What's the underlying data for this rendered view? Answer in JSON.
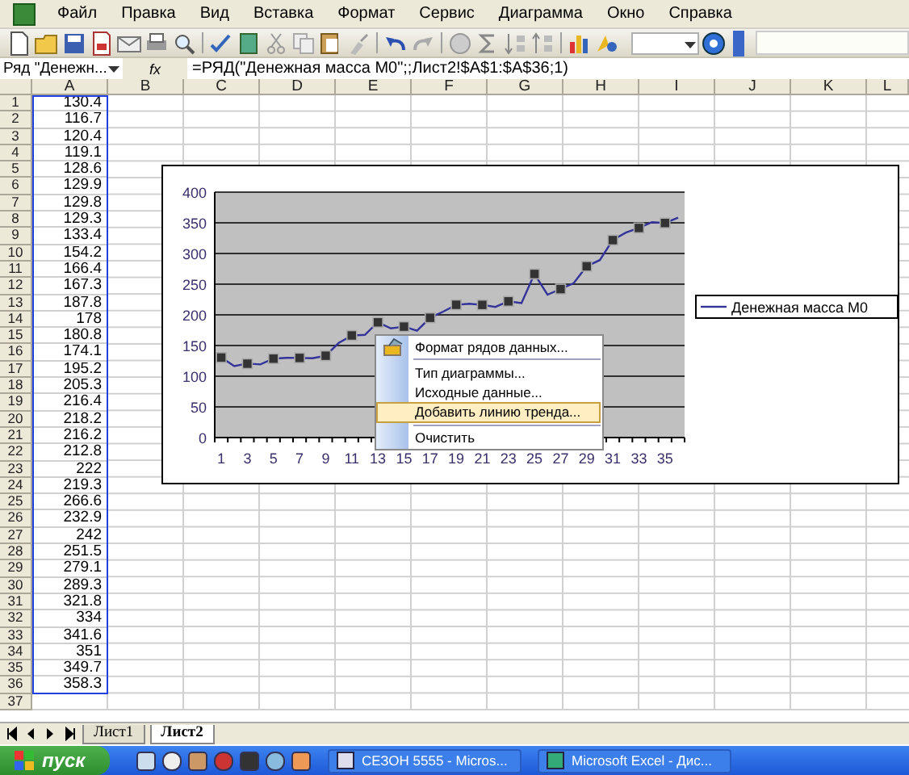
{
  "menu": [
    "Файл",
    "Правка",
    "Вид",
    "Вставка",
    "Формат",
    "Сервис",
    "Диаграмма",
    "Окно",
    "Справка"
  ],
  "formula_bar": {
    "name_box": "Ряд \"Денежн...",
    "fx": "fx",
    "formula": "=РЯД(\"Денежная масса M0\";;Лист2!$A$1:$A$36;1)"
  },
  "sheet": {
    "columns": [
      "A",
      "B",
      "C",
      "D",
      "E",
      "F",
      "G",
      "H",
      "I",
      "J",
      "K",
      "L"
    ],
    "row_numbers": [
      "1",
      "2",
      "3",
      "4",
      "5",
      "6",
      "7",
      "8",
      "9",
      "10",
      "11",
      "12",
      "13",
      "14",
      "15",
      "16",
      "17",
      "18",
      "19",
      "20",
      "21",
      "22",
      "23",
      "24",
      "25",
      "26",
      "27",
      "28",
      "29",
      "30",
      "31",
      "32",
      "33",
      "34",
      "35",
      "36",
      "37"
    ],
    "column_a": [
      "130.4",
      "116.7",
      "120.4",
      "119.1",
      "128.6",
      "129.9",
      "129.8",
      "129.3",
      "133.4",
      "154.2",
      "166.4",
      "167.3",
      "187.8",
      "178",
      "180.8",
      "174.1",
      "195.2",
      "205.3",
      "216.4",
      "218.2",
      "216.2",
      "212.8",
      "222",
      "219.3",
      "266.6",
      "232.9",
      "242",
      "251.5",
      "279.1",
      "289.3",
      "321.8",
      "334",
      "341.6",
      "351",
      "349.7",
      "358.3"
    ],
    "range_highlighted": true
  },
  "chart": {
    "chart_data": {
      "type": "line",
      "x": [
        1,
        2,
        3,
        4,
        5,
        6,
        7,
        8,
        9,
        10,
        11,
        12,
        13,
        14,
        15,
        16,
        17,
        18,
        19,
        20,
        21,
        22,
        23,
        24,
        25,
        26,
        27,
        28,
        29,
        30,
        31,
        32,
        33,
        34,
        35,
        36
      ],
      "grid": true,
      "series": [
        {
          "name": "Денежная масса M0",
          "color": "#333399",
          "values": [
            130.4,
            116.7,
            120.4,
            119.1,
            128.6,
            129.9,
            129.8,
            129.3,
            133.4,
            154.2,
            166.4,
            167.3,
            187.8,
            178,
            180.8,
            174.1,
            195.2,
            205.3,
            216.4,
            218.2,
            216.2,
            212.8,
            222,
            219.3,
            266.6,
            232.9,
            242,
            251.5,
            279.1,
            289.3,
            321.8,
            334,
            341.6,
            351,
            349.7,
            358.3
          ]
        }
      ],
      "xlim": [
        0.5,
        36.5
      ],
      "ylim": [
        0,
        400
      ],
      "yticks": [
        0,
        50,
        100,
        150,
        200,
        250,
        300,
        350,
        400
      ],
      "xticks": [
        1,
        3,
        5,
        7,
        9,
        11,
        13,
        15,
        17,
        19,
        21,
        23,
        25,
        27,
        29,
        31,
        33,
        35
      ]
    }
  },
  "context_menu": [
    {
      "label": "Формат рядов данных...",
      "selected": false,
      "separator_after": true,
      "icon": true
    },
    {
      "label": "Тип диаграммы...",
      "selected": false,
      "separator_after": false,
      "icon": false
    },
    {
      "label": "Исходные данные...",
      "selected": false,
      "separator_after": false,
      "icon": false
    },
    {
      "label": "Добавить линию тренда...",
      "selected": true,
      "separator_after": true,
      "icon": false
    },
    {
      "label": "Очистить",
      "selected": false,
      "separator_after": false,
      "icon": false
    }
  ],
  "sheet_tabs": [
    {
      "label": "Лист1",
      "selected": false
    },
    {
      "label": "Лист2",
      "selected": true
    }
  ],
  "taskbar": {
    "start": "пуск",
    "tasks": [
      {
        "label": "СЕЗОН 5555 - Micros...",
        "selected": false
      },
      {
        "label": "Microsoft Excel - Дис...",
        "selected": false
      }
    ]
  }
}
